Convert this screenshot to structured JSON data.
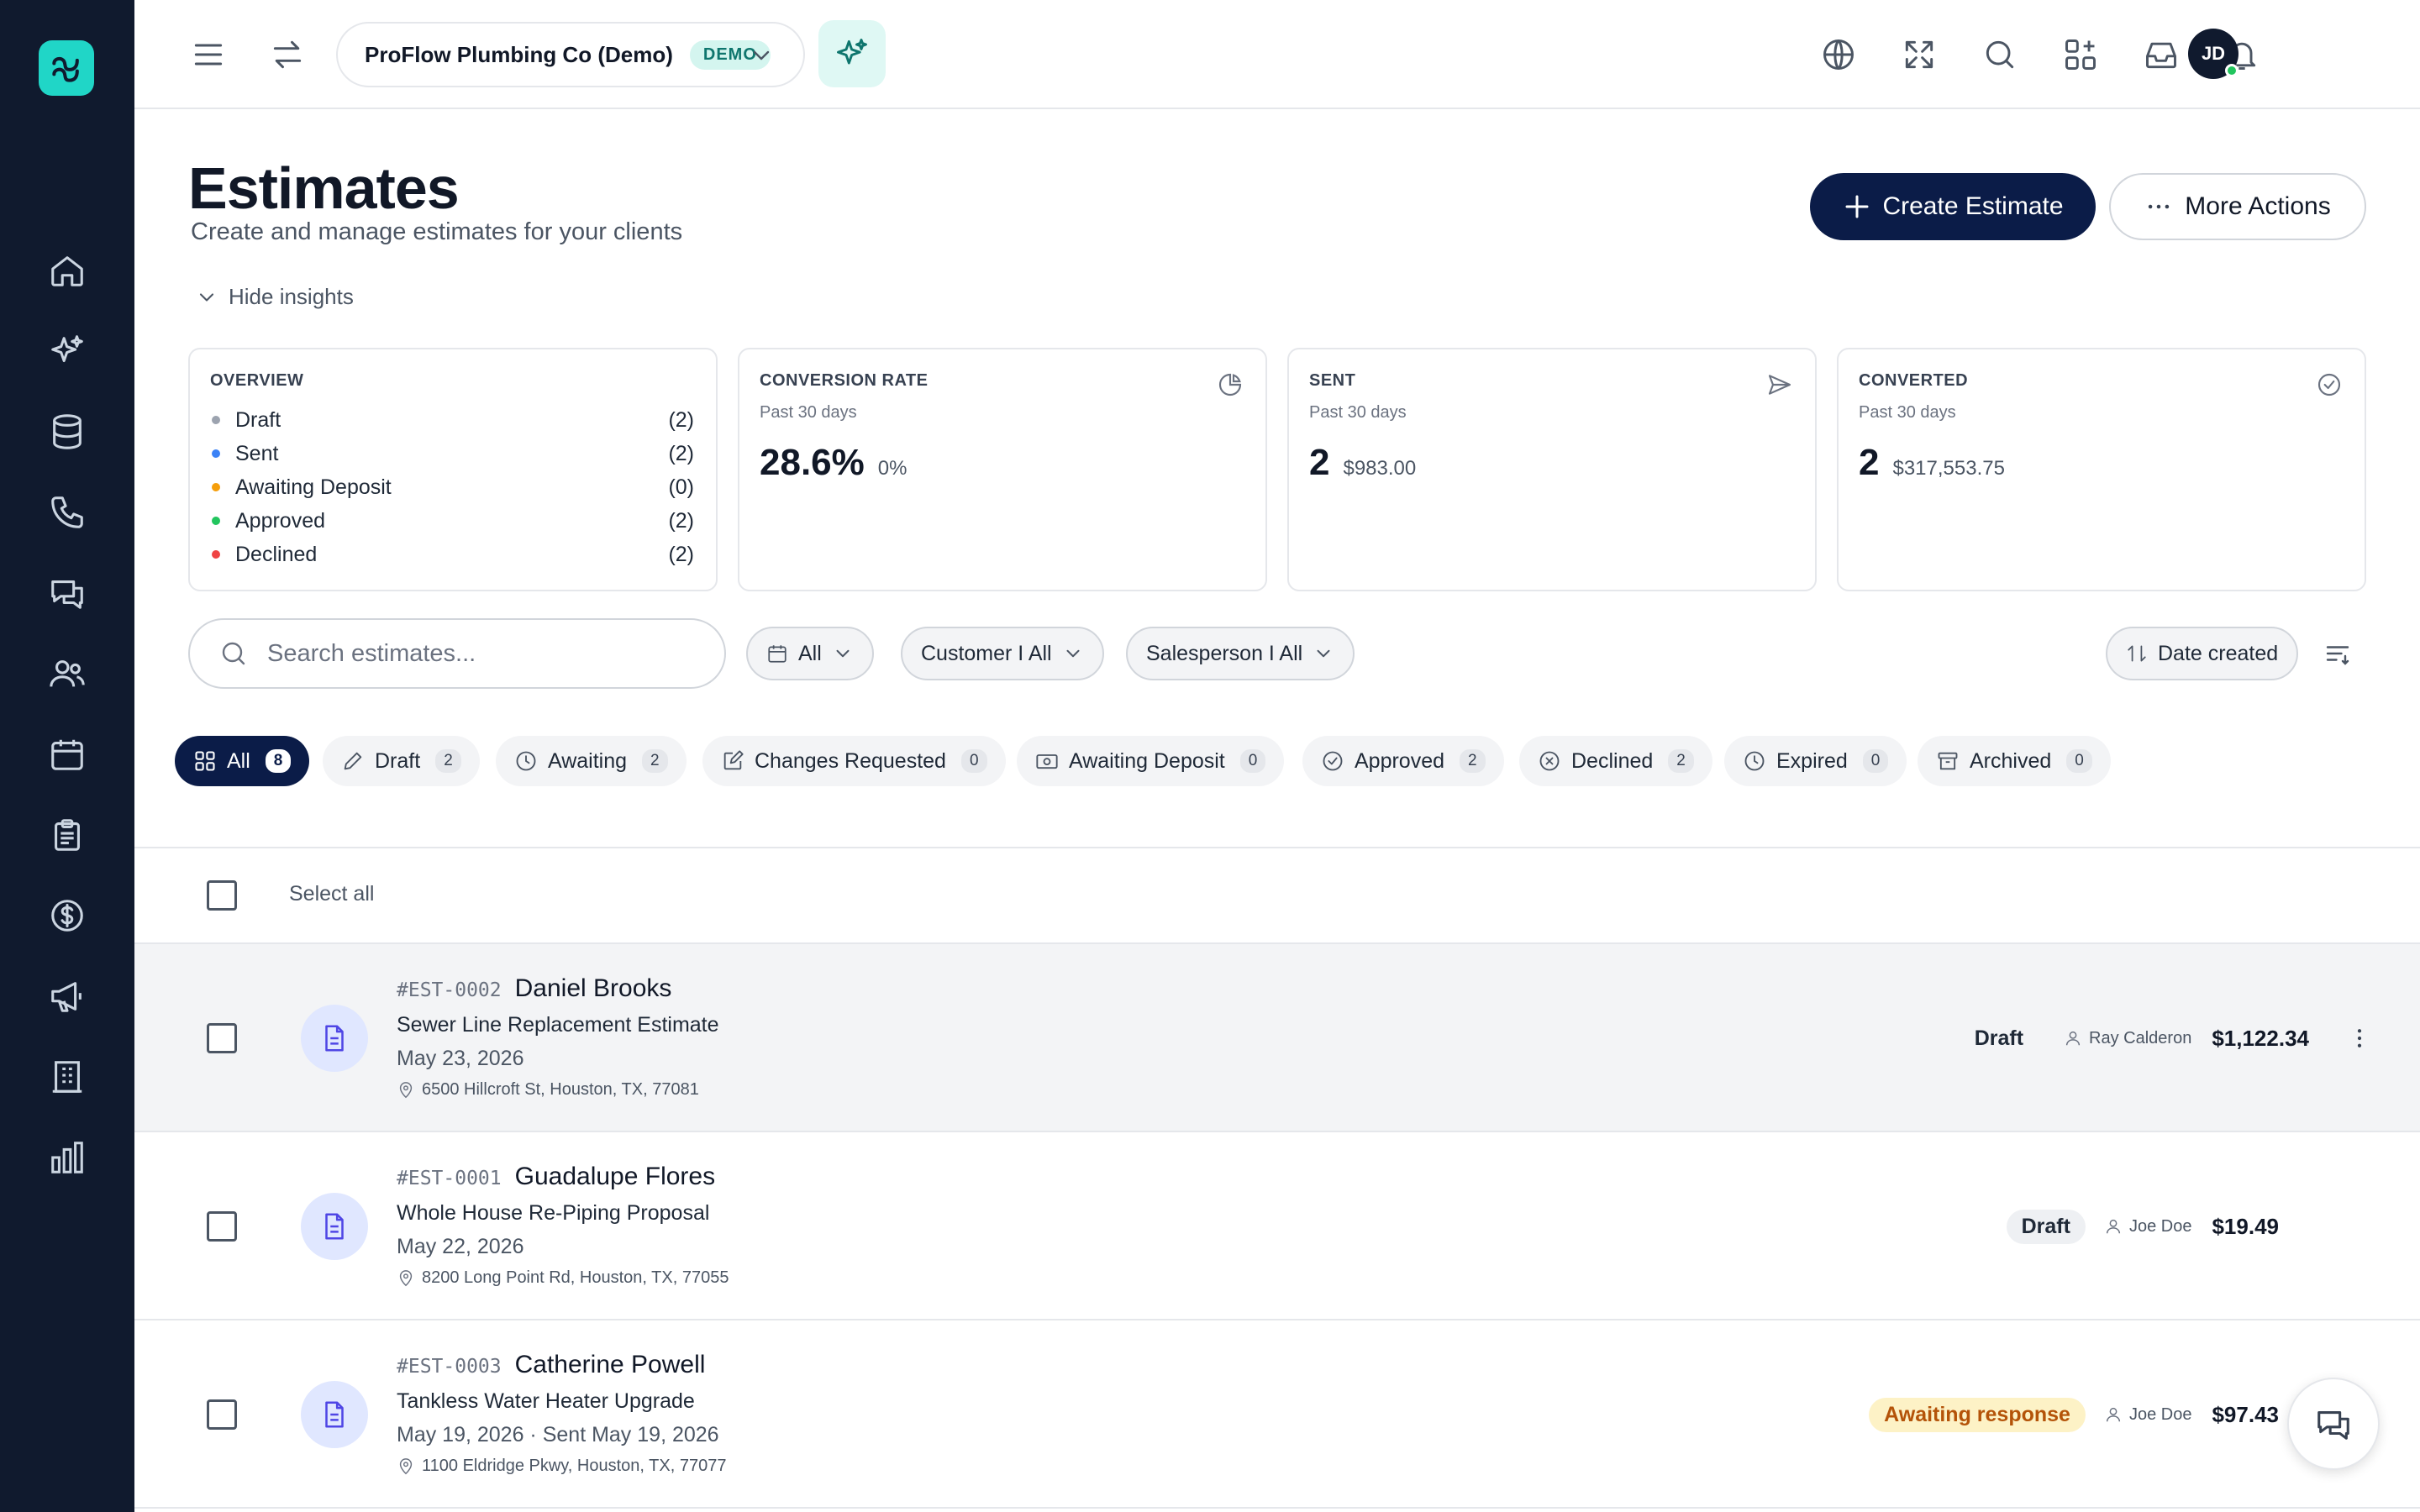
{
  "topbar": {
    "company_name": "ProFlow Plumbing Co (Demo)",
    "company_badge": "DEMO",
    "avatar_initials": "JD"
  },
  "header": {
    "title": "Estimates",
    "subtitle": "Create and manage estimates for your clients",
    "create_label": "Create Estimate",
    "more_label": "More Actions",
    "hide_insights": "Hide insights"
  },
  "overview": {
    "title": "OVERVIEW",
    "items": [
      {
        "label": "Draft",
        "count": "(2)",
        "color": "#9ca3af"
      },
      {
        "label": "Sent",
        "count": "(2)",
        "color": "#3b82f6"
      },
      {
        "label": "Awaiting Deposit",
        "count": "(0)",
        "color": "#f59e0b"
      },
      {
        "label": "Approved",
        "count": "(2)",
        "color": "#22c55e"
      },
      {
        "label": "Declined",
        "count": "(2)",
        "color": "#ef4444"
      }
    ]
  },
  "cards": {
    "conversion": {
      "title": "CONVERSION RATE",
      "period": "Past 30 days",
      "value": "28.6%",
      "secondary": "0%"
    },
    "sent": {
      "title": "SENT",
      "period": "Past 30 days",
      "value": "2",
      "secondary": "$983.00"
    },
    "converted": {
      "title": "CONVERTED",
      "period": "Past 30 days",
      "value": "2",
      "secondary": "$317,553.75"
    }
  },
  "filters": {
    "search_placeholder": "Search estimates...",
    "date_filter": "All",
    "customer_filter": "Customer I All",
    "salesperson_filter": "Salesperson I All",
    "sort_label": "Date created"
  },
  "tabs": [
    {
      "label": "All",
      "count": "8"
    },
    {
      "label": "Draft",
      "count": "2"
    },
    {
      "label": "Awaiting",
      "count": "2"
    },
    {
      "label": "Changes Requested",
      "count": "0"
    },
    {
      "label": "Awaiting Deposit",
      "count": "0"
    },
    {
      "label": "Approved",
      "count": "2"
    },
    {
      "label": "Declined",
      "count": "2"
    },
    {
      "label": "Expired",
      "count": "0"
    },
    {
      "label": "Archived",
      "count": "0"
    }
  ],
  "list": {
    "select_all": "Select all",
    "rows": [
      {
        "number": "#EST-0002",
        "customer": "Daniel Brooks",
        "title": "Sewer Line Replacement Estimate",
        "date": "May 23, 2026",
        "address": "6500 Hillcroft St, Houston, TX, 77081",
        "status": "Draft",
        "salesperson": "Ray Calderon",
        "amount": "$1,122.34"
      },
      {
        "number": "#EST-0001",
        "customer": "Guadalupe Flores",
        "title": "Whole House Re-Piping Proposal",
        "date": "May 22, 2026",
        "address": "8200 Long Point Rd, Houston, TX, 77055",
        "status": "Draft",
        "salesperson": "Joe Doe",
        "amount": "$19.49"
      },
      {
        "number": "#EST-0003",
        "customer": "Catherine Powell",
        "title": "Tankless Water Heater Upgrade",
        "date": "May 19, 2026 · Sent May 19, 2026",
        "address": "1100 Eldridge Pkwy, Houston, TX, 77077",
        "status": "Awaiting response",
        "salesperson": "Joe Doe",
        "amount": "$97.43"
      }
    ]
  },
  "icons": {
    "sidebar": [
      "home-icon",
      "sparkles-icon",
      "database-icon",
      "phone-icon",
      "chat-icon",
      "users-icon",
      "calendar-icon",
      "clipboard-icon",
      "dollar-icon",
      "megaphone-icon",
      "building-icon",
      "bar-chart-icon"
    ],
    "topbar": [
      "menu-icon",
      "swap-icon",
      "globe-icon",
      "fullscreen-icon",
      "search-icon",
      "apps-icon",
      "inbox-icon",
      "bell-icon"
    ]
  },
  "colors": {
    "sidebar_bg": "#101a2e",
    "brand_accent": "#20d6c7",
    "primary_button": "#0b1c48",
    "awaiting_badge_bg": "#fdf2c6",
    "awaiting_badge_text": "#b45309"
  }
}
